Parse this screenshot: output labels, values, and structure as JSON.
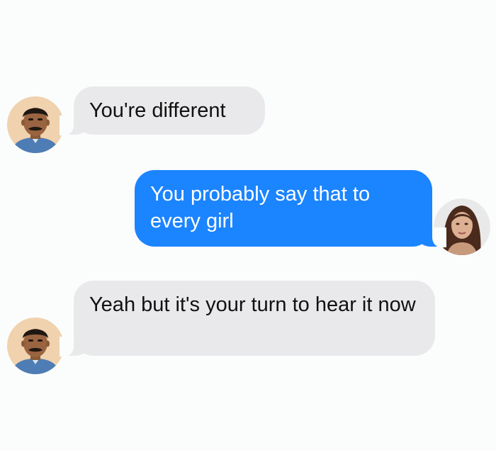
{
  "conversation": {
    "messages": [
      {
        "sender": "him",
        "direction": "incoming",
        "text": "You're different"
      },
      {
        "sender": "her",
        "direction": "outgoing",
        "text": "You probably say that to every girl"
      },
      {
        "sender": "him",
        "direction": "incoming",
        "text": "Yeah but it's your turn to hear it now"
      }
    ]
  },
  "colors": {
    "page_background": "#fbfdfd",
    "incoming_bubble": "#e9e9eb",
    "outgoing_bubble": "#1b84ff",
    "outgoing_text": "#ffffff",
    "incoming_text": "#111111"
  },
  "icons": {
    "incoming_avatar": "man-avatar-icon",
    "outgoing_avatar": "woman-avatar-icon"
  }
}
